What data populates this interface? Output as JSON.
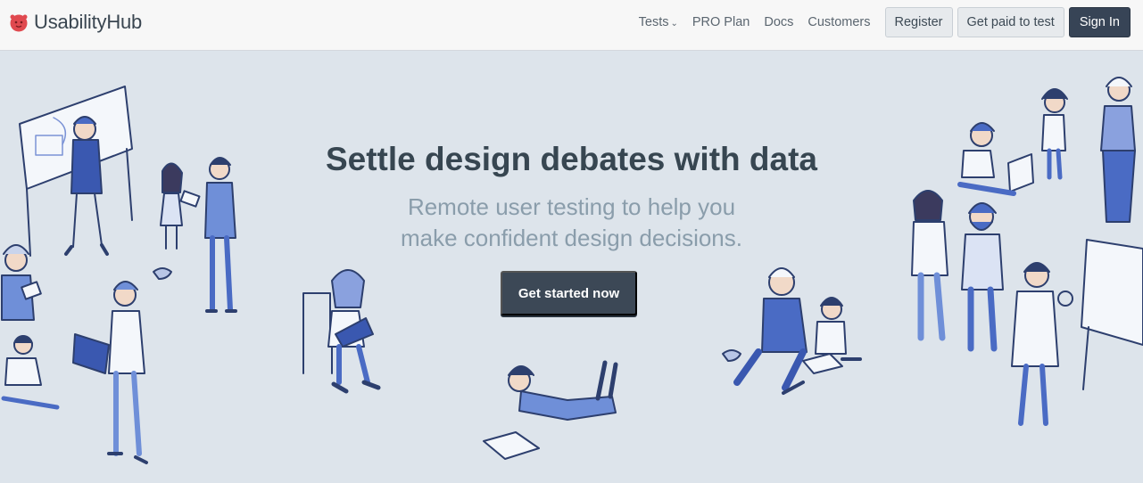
{
  "header": {
    "brand": "UsabilityHub",
    "nav": {
      "tests": "Tests",
      "pro_plan": "PRO Plan",
      "docs": "Docs",
      "customers": "Customers"
    },
    "register_label": "Register",
    "get_paid_label": "Get paid to test",
    "sign_in_label": "Sign In"
  },
  "hero": {
    "headline": "Settle design debates with data",
    "subline_1": "Remote user testing to help you",
    "subline_2": "make confident design decisions.",
    "cta_label": "Get started now"
  },
  "colors": {
    "navbar_bg": "#f7f7f7",
    "hero_bg": "#dde4eb",
    "primary_dark": "#374456",
    "illustration_blue": "#4a6bc4",
    "logo_red": "#e0494f"
  }
}
